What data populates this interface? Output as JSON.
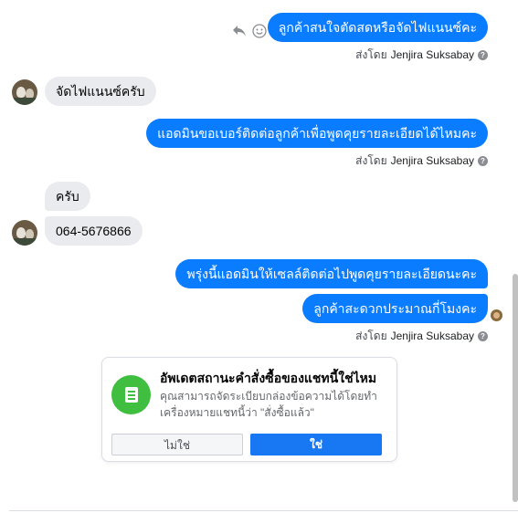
{
  "messages": [
    {
      "text": "ลูกค้าสนใจตัดสดหรือจัดไฟแนนซ์คะ"
    },
    {
      "text": "จัดไฟแนนซ์ครับ"
    },
    {
      "text": "แอดมินขอเบอร์ติดต่อลูกค้าเพื่อพูดคุยรายละเอียดได้ไหมคะ"
    },
    {
      "text": "ครับ"
    },
    {
      "text": "064-5676866"
    },
    {
      "text": "พรุ่งนี้แอดมินให้เซลล์ติดต่อไปพูดคุยรายละเอียดนะคะ"
    },
    {
      "text": "ลูกค้าสะดวกประมาณกี่โมงคะ"
    }
  ],
  "sent_by": {
    "prefix": "ส่งโดย",
    "name": "Jenjira Suksabay",
    "help": "?"
  },
  "hover_actions": {
    "reply_icon": "reply-icon",
    "react_icon": "smiley-icon"
  },
  "order_card": {
    "title": "อัพเดตสถานะคำสั่งซื้อของแชทนี้ใช่ไหม",
    "description": "คุณสามารถจัดระเบียบกล่องข้อความได้โดยทำเครื่องหมายแชทนี้ว่า \"สั่งซื้อแล้ว\"",
    "no_label": "ไม่ใช่",
    "yes_label": "ใช่",
    "icon": "order-document-icon",
    "icon_color": "#3fbe3f"
  },
  "colors": {
    "outgoing": "#0a7cff",
    "incoming": "#e9ebef",
    "primary_button": "#1877f2"
  }
}
